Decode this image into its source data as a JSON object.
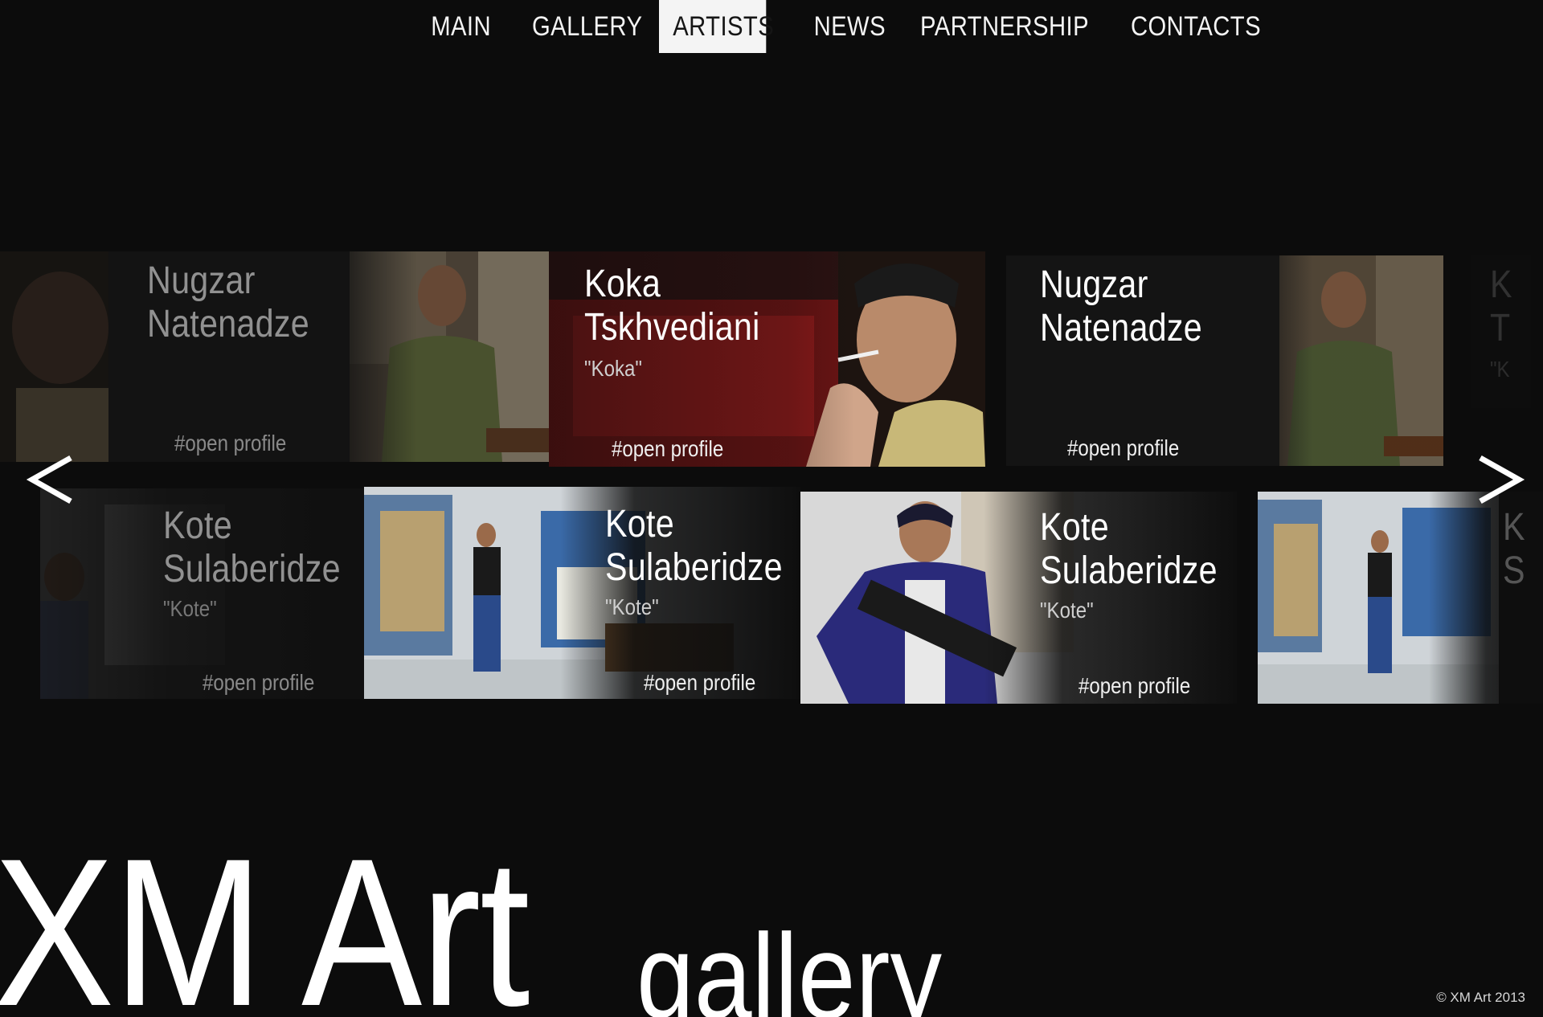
{
  "nav": {
    "items": [
      "MAIN",
      "GALLERY",
      "ARTISTS",
      "NEWS",
      "PARTNERSHIP",
      "CONTACTS"
    ],
    "active": "ARTISTS"
  },
  "carousel": {
    "prev_glyph": "<",
    "next_glyph": ">",
    "row1": [
      {
        "name_line1": "Nugzar",
        "name_line2": "Natenadze",
        "nickname": "",
        "link": "#open profile"
      },
      {
        "name_line1": "Koka",
        "name_line2": "Tskhvediani",
        "nickname": "\"Koka\"",
        "link": "#open profile"
      },
      {
        "name_line1": "Nugzar",
        "name_line2": "Natenadze",
        "nickname": "",
        "link": "#open profile"
      },
      {
        "name_line1": "K",
        "name_line2": "T",
        "nickname": "\"K",
        "link": ""
      }
    ],
    "row2": [
      {
        "name_line1": "Kote",
        "name_line2": "Sulaberidze",
        "nickname": "\"Kote\"",
        "link": "#open profile"
      },
      {
        "name_line1": "Kote",
        "name_line2": "Sulaberidze",
        "nickname": "\"Kote\"",
        "link": "#open profile"
      },
      {
        "name_line1": "Kote",
        "name_line2": "Sulaberidze",
        "nickname": "\"Kote\"",
        "link": "#open profile"
      },
      {
        "name_line1": "K",
        "name_line2": "S",
        "nickname": "",
        "link": ""
      }
    ]
  },
  "footer": {
    "logo_main": "XM Art",
    "logo_sub": "gallery",
    "copyright": "© XM Art 2013"
  },
  "colors": {
    "background": "#0c0c0c",
    "text": "#ffffff",
    "active_nav_bg": "#f4f4f4",
    "active_nav_text": "#151515"
  }
}
